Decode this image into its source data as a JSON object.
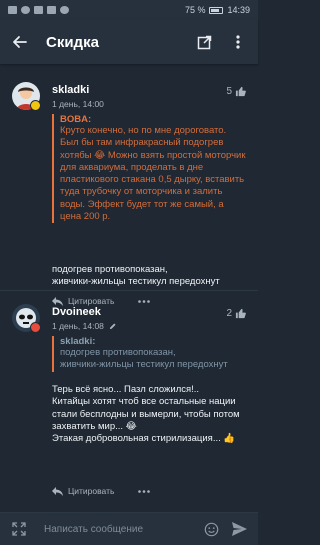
{
  "status_bar": {
    "battery": "75 %",
    "time": "14:39"
  },
  "app_bar": {
    "title": "Скидка"
  },
  "comments": [
    {
      "author": "skladki",
      "time": "1 день, 14:00",
      "likes": "5",
      "quote": {
        "author": "BOBA:",
        "text": "Круто конечно, но по мне дороговато. Был бы там инфракрасный подогрев хотябы 😂 Можно взять простой моторчик  для аквариума, проделать в дне пластикового стакана 0,5 дырку, вставить туда трубочку от моторчика и залить воды. Эффект будет тот же самый, а цена 200 р."
      },
      "body": "подогрев противопоказан,\nживчики-жильцы тестикул передохнут",
      "reply_label": "Цитировать",
      "avatar_color": "#f1c40f"
    },
    {
      "author": "Dvoineek",
      "time": "1 день, 14:08",
      "likes": "2",
      "quote": {
        "author": "skladki:",
        "text": "подогрев противопоказан,\nживчики-жильцы тестикул передохнут"
      },
      "body": "Терь всё ясно... Пазл сложился!..\n  Китайцы хотят чтоб все остальные нации стали бесплодны и вымерли, чтобы потом захватить мир... 😂\n  Этакая добровольная стирилизация... 👍",
      "reply_label": "Цитировать",
      "avatar_color": "#e74c3c"
    }
  ],
  "composer": {
    "placeholder": "Написать сообщение"
  },
  "colors": {
    "background": "#1f2833",
    "bar": "#26313d",
    "quote_accent": "#e8743b"
  }
}
